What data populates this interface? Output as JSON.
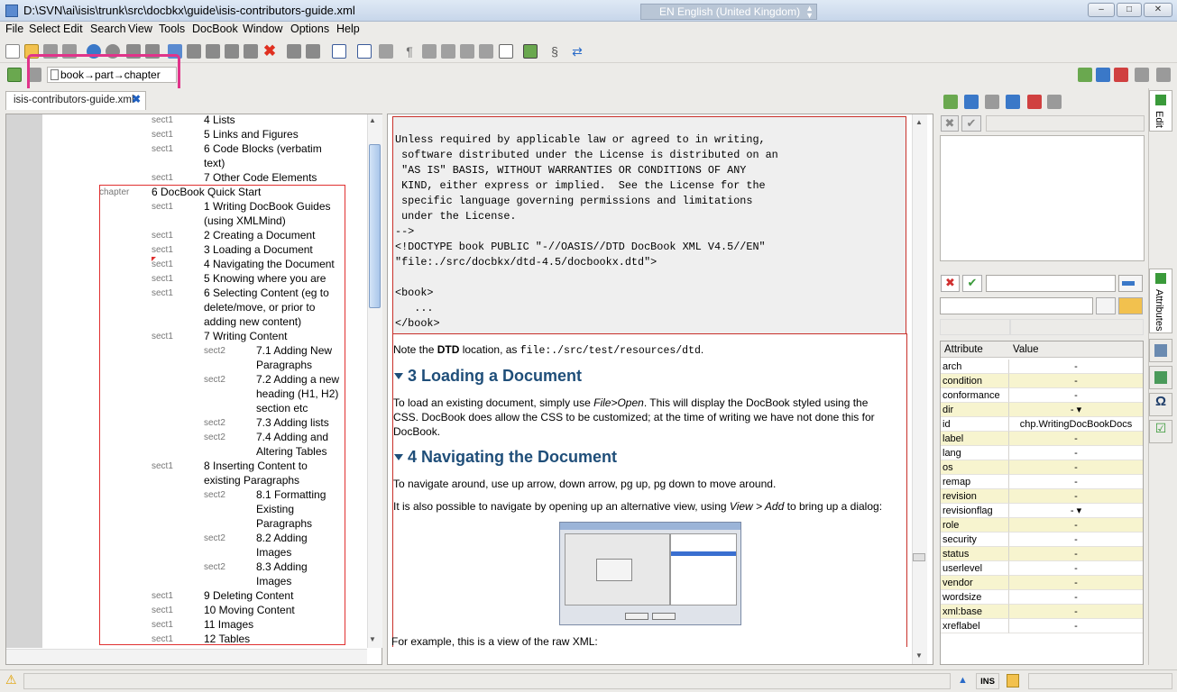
{
  "window": {
    "title": "D:\\SVN\\ai\\isis\\trunk\\src\\docbkx\\guide\\isis-contributors-guide.xml",
    "language_indicator": "EN English (United Kingdom)",
    "minimize": "–",
    "maximize": "□",
    "close": "✕"
  },
  "menu": [
    "File",
    "Select",
    "Edit",
    "Search",
    "View",
    "Tools",
    "DocBook",
    "Window",
    "Options",
    "Help"
  ],
  "pathbar": {
    "path": "book→part→chapter"
  },
  "document_tab": {
    "label": "isis-contributors-guide.xml"
  },
  "outline": {
    "rows": [
      {
        "type": "sect1",
        "label": "4 Lists"
      },
      {
        "type": "sect1",
        "label": "5 Links and Figures"
      },
      {
        "type": "sect1",
        "label": "6 Code Blocks (verbatim"
      },
      {
        "type": "",
        "label": "text)"
      },
      {
        "type": "sect1",
        "label": "7 Other Code Elements"
      },
      {
        "type": "chapter",
        "label": "6 DocBook Quick Start"
      },
      {
        "type": "sect1",
        "label": "1 Writing DocBook Guides"
      },
      {
        "type": "",
        "label": "(using XMLMind)"
      },
      {
        "type": "sect1",
        "label": "2 Creating a Document"
      },
      {
        "type": "sect1",
        "label": "3 Loading a Document"
      },
      {
        "type": "sect1",
        "label": "4 Navigating the Document"
      },
      {
        "type": "sect1",
        "label": "5 Knowing where you are"
      },
      {
        "type": "sect1",
        "label": "6 Selecting Content (eg to"
      },
      {
        "type": "",
        "label": "delete/move, or prior to"
      },
      {
        "type": "",
        "label": "adding new content)"
      },
      {
        "type": "sect1",
        "label": "7 Writing Content"
      },
      {
        "type": "sect2",
        "label": "7.1 Adding New"
      },
      {
        "type": "",
        "label": "Paragraphs"
      },
      {
        "type": "sect2",
        "label": "7.2 Adding a new"
      },
      {
        "type": "",
        "label": "heading (H1, H2)"
      },
      {
        "type": "",
        "label": "section etc"
      },
      {
        "type": "sect2",
        "label": "7.3 Adding lists"
      },
      {
        "type": "sect2",
        "label": "7.4 Adding and"
      },
      {
        "type": "",
        "label": "Altering Tables"
      },
      {
        "type": "sect1",
        "label": "8 Inserting Content to"
      },
      {
        "type": "",
        "label": "existing Paragraphs"
      },
      {
        "type": "sect2",
        "label": "8.1 Formatting"
      },
      {
        "type": "",
        "label": "Existing"
      },
      {
        "type": "",
        "label": "Paragraphs"
      },
      {
        "type": "sect2",
        "label": "8.2 Adding"
      },
      {
        "type": "",
        "label": "Images"
      },
      {
        "type": "sect2",
        "label": "8.3 Adding"
      },
      {
        "type": "",
        "label": "Images"
      },
      {
        "type": "sect1",
        "label": "9 Deleting Content"
      },
      {
        "type": "sect1",
        "label": "10 Moving Content"
      },
      {
        "type": "sect1",
        "label": "11 Images"
      },
      {
        "type": "sect1",
        "label": "12 Tables"
      }
    ]
  },
  "editor": {
    "code": "Unless required by applicable law or agreed to in writing,\n software distributed under the License is distributed on an\n \"AS IS\" BASIS, WITHOUT WARRANTIES OR CONDITIONS OF ANY\n KIND, either express or implied.  See the License for the\n specific language governing permissions and limitations\n under the License.\n-->\n<!DOCTYPE book PUBLIC \"-//OASIS//DTD DocBook XML V4.5//EN\"\n\"file:./src/docbkx/dtd-4.5/docbookx.dtd\">\n\n<book>\n   ...\n</book>",
    "dtd_note_pre": "Note the ",
    "dtd_note_bold": "DTD",
    "dtd_note_mid": " location, as ",
    "dtd_note_code": "file:./src/test/resources/dtd",
    "dtd_note_post": ".",
    "h3": "3 Loading a Document",
    "p3_pre": "To load an existing document, simply use ",
    "p3_em": "File>Open",
    "p3_post": ". This will display the DocBook styled using the",
    "p3_line2": "CSS.  DocBook does allow the CSS to be customized; at the time of writing we have not done this for",
    "p3_line3": "DocBook.",
    "h4": "4 Navigating the Document",
    "p4": "To navigate around, use up arrow, down arrow, pg up, pg down to move around.",
    "p5_pre": "It is also possible to navigate by opening up an alternative view, using ",
    "p5_em": "View > Add",
    "p5_post": " to bring up a dialog:",
    "p6": "For example, this is a view of the raw XML:"
  },
  "attributes": {
    "header_name": "Attribute",
    "header_value": "Value",
    "rows": [
      {
        "name": "arch",
        "value": "-",
        "req": false
      },
      {
        "name": "condition",
        "value": "-",
        "req": true
      },
      {
        "name": "conformance",
        "value": "-",
        "req": false
      },
      {
        "name": "dir",
        "value": "- ▾",
        "req": true
      },
      {
        "name": "id",
        "value": "chp.WritingDocBookDocs",
        "req": false
      },
      {
        "name": "label",
        "value": "-",
        "req": true
      },
      {
        "name": "lang",
        "value": "-",
        "req": false
      },
      {
        "name": "os",
        "value": "-",
        "req": true
      },
      {
        "name": "remap",
        "value": "-",
        "req": false
      },
      {
        "name": "revision",
        "value": "-",
        "req": true
      },
      {
        "name": "revisionflag",
        "value": "- ▾",
        "req": false
      },
      {
        "name": "role",
        "value": "-",
        "req": true
      },
      {
        "name": "security",
        "value": "-",
        "req": false
      },
      {
        "name": "status",
        "value": "-",
        "req": true
      },
      {
        "name": "userlevel",
        "value": "-",
        "req": false
      },
      {
        "name": "vendor",
        "value": "-",
        "req": true
      },
      {
        "name": "wordsize",
        "value": "-",
        "req": false
      },
      {
        "name": "xml:base",
        "value": "-",
        "req": true
      },
      {
        "name": "xreflabel",
        "value": "-",
        "req": false
      }
    ]
  },
  "side_tabs": {
    "edit": "Edit",
    "attributes": "Attributes"
  },
  "status": {
    "ins": "INS"
  },
  "colors": {
    "accent_highlight": "#e0348a",
    "heading": "#1f4e79",
    "selection_box": "#e03030"
  }
}
